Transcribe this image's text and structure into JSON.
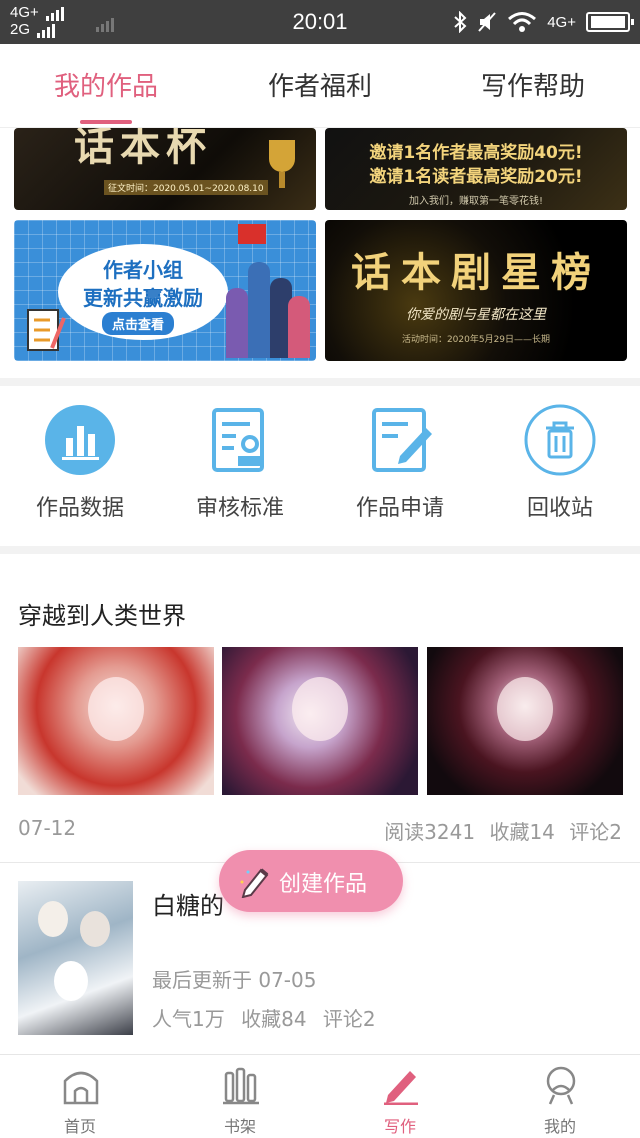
{
  "status_bar": {
    "network_1": "4G+",
    "network_2": "2G",
    "network_3": "4G+",
    "time": "20:01"
  },
  "tabs": [
    {
      "label": "我的作品",
      "active": true
    },
    {
      "label": "作者福利",
      "active": false
    },
    {
      "label": "写作帮助",
      "active": false
    }
  ],
  "banners": {
    "b1": {
      "title": "话本杯",
      "subtitle": "征文时间：2020.05.01~2020.08.10"
    },
    "b2": {
      "line1": "邀请1名作者最高奖励40元!",
      "line2": "邀请1名读者最高奖励20元!",
      "footer": "加入我们，赚取第一笔零花钱!"
    },
    "b3": {
      "line1": "作者小组",
      "line2": "更新共赢激励",
      "button": "点击查看"
    },
    "b4": {
      "title": "话本剧星榜",
      "subtitle": "你爱的剧与星都在这里",
      "footer": "活动时间：2020年5月29日——长期"
    }
  },
  "quick_actions": [
    {
      "label": "作品数据",
      "icon": "bar-chart-icon"
    },
    {
      "label": "审核标准",
      "icon": "review-standard-icon"
    },
    {
      "label": "作品申请",
      "icon": "apply-edit-icon"
    },
    {
      "label": "回收站",
      "icon": "trash-icon"
    }
  ],
  "works": [
    {
      "title": "穿越到人类世界",
      "date": "07-12",
      "read": "阅读3241",
      "favorites": "收藏14",
      "comments": "评论2"
    },
    {
      "title": "白糖的",
      "updated": "最后更新于 07-05",
      "popularity": "人气1万",
      "favorites": "收藏84",
      "comments": "评论2"
    }
  ],
  "fab": {
    "label": "创建作品",
    "icon": "pencil-icon"
  },
  "bottom_nav": [
    {
      "label": "首页",
      "icon": "home-icon",
      "active": false
    },
    {
      "label": "书架",
      "icon": "bookshelf-icon",
      "active": false
    },
    {
      "label": "写作",
      "icon": "write-icon",
      "active": true
    },
    {
      "label": "我的",
      "icon": "profile-icon",
      "active": false
    }
  ],
  "colors": {
    "accent": "#e0607e",
    "fab": "#f08fae",
    "icon_blue": "#5ab4e8"
  }
}
